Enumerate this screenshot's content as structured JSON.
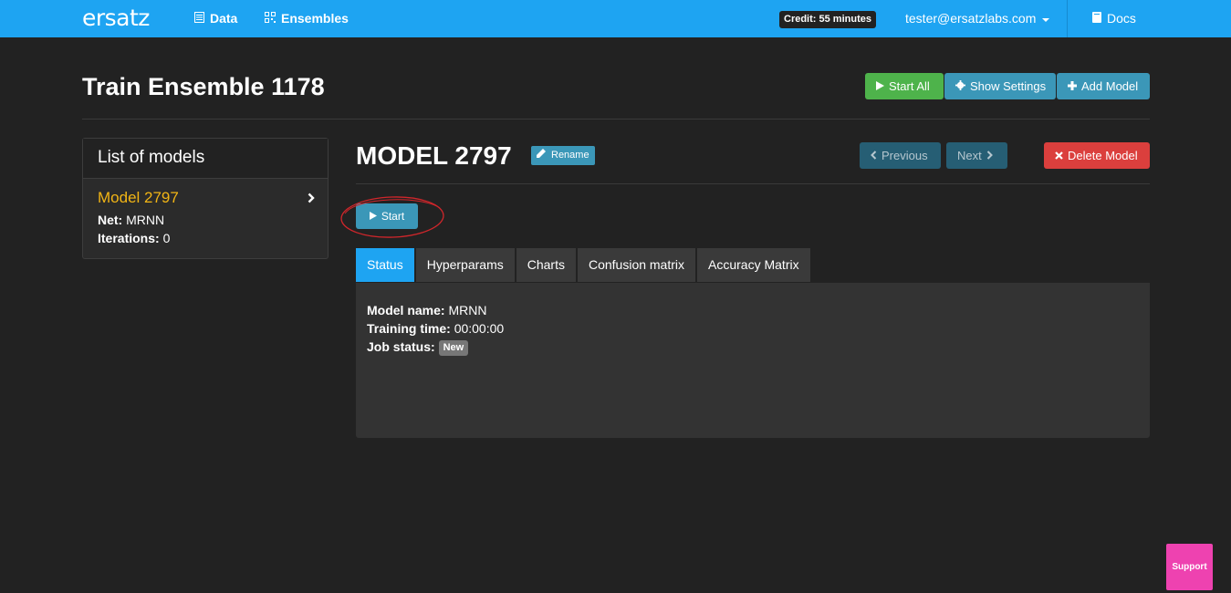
{
  "navbar": {
    "brand": "ersatz",
    "links": [
      {
        "label": "Data",
        "icon": "list-icon"
      },
      {
        "label": "Ensembles",
        "icon": "qrcode-icon"
      }
    ],
    "credit": "Credit: 55 minutes",
    "user": "tester@ersatzlabs.com",
    "docs": "Docs",
    "color": "#1ea4f2"
  },
  "header": {
    "title": "Train Ensemble 1178",
    "buttons": {
      "start_all": "Start All",
      "show_settings": "Show Settings",
      "add_model": "Add Model"
    }
  },
  "sidebar": {
    "heading": "List of models",
    "items": [
      {
        "name": "Model 2797",
        "net_label": "Net:",
        "net_value": "MRNN",
        "iter_label": "Iterations:",
        "iter_value": "0"
      }
    ]
  },
  "model": {
    "title": "MODEL 2797",
    "rename": "Rename",
    "previous": "Previous",
    "next": "Next",
    "delete": "Delete Model",
    "start": "Start"
  },
  "tabs": [
    "Status",
    "Hyperparams",
    "Charts",
    "Confusion matrix",
    "Accuracy Matrix"
  ],
  "active_tab": "Status",
  "status": {
    "model_name_label": "Model name:",
    "model_name": "MRNN",
    "training_time_label": "Training time:",
    "training_time": "00:00:00",
    "job_status_label": "Job status:",
    "job_status": "New"
  },
  "support": "Support"
}
